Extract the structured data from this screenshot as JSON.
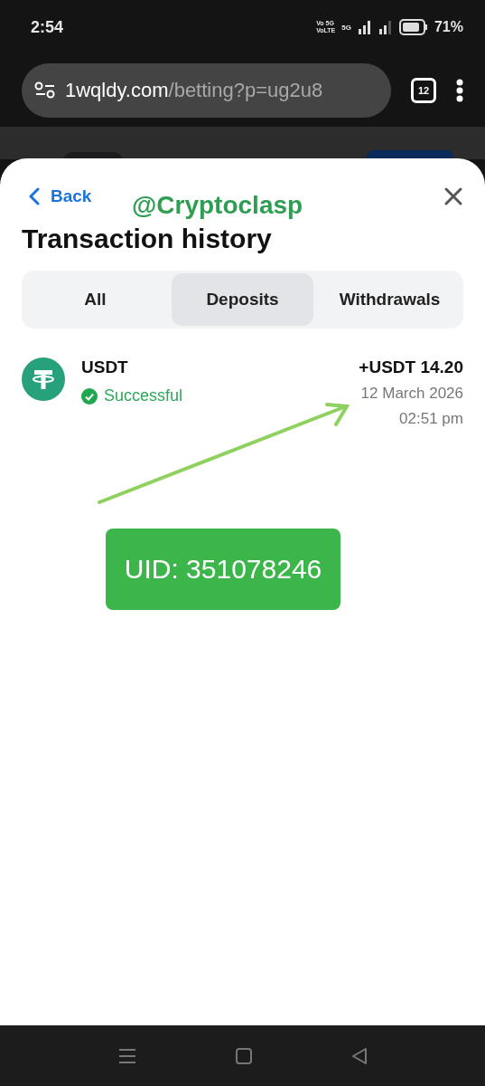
{
  "status_bar": {
    "time": "2:54",
    "network_top": "Vo 5G",
    "network_bottom": "VoLTE",
    "data_type": "5G",
    "battery": "71%"
  },
  "browser": {
    "url_host": "1wqldy.com",
    "url_path": "/betting?p=ug2u8",
    "tab_count": "12"
  },
  "sheet": {
    "back": "Back",
    "title": "Transaction history",
    "tabs": [
      {
        "label": "All",
        "selected": false
      },
      {
        "label": "Deposits",
        "selected": true
      },
      {
        "label": "Withdrawals",
        "selected": false
      }
    ],
    "transactions": [
      {
        "currency": "USDT",
        "status": "Successful",
        "amount": "+USDT 14.20",
        "date": "12 March 2026",
        "time": "02:51 pm"
      }
    ]
  },
  "annotations": {
    "watermark": "@Cryptoclasp",
    "uid_label": "UID: 351078246"
  }
}
